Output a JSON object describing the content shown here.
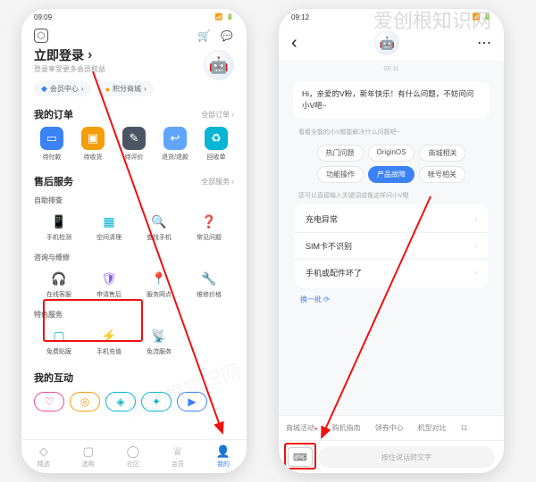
{
  "watermark": "爱创根知识网",
  "phone1": {
    "time": "09:09",
    "login_title": "立即登录",
    "login_sub": "登录享受更多会员权益",
    "pills": {
      "member": "会员中心",
      "points": "积分商城"
    },
    "sections": {
      "orders": {
        "title": "我的订单",
        "more": "全部订单 ›",
        "items": [
          "待付款",
          "待收货",
          "待评价",
          "退货/退款",
          "回收单"
        ]
      },
      "aftersale": {
        "title": "售后服务",
        "more": "全部服务 ›"
      },
      "selfcheck": {
        "title": "自助排查",
        "items": [
          "手机检测",
          "空间清理",
          "查找手机",
          "常见问题"
        ]
      },
      "consult": {
        "title": "咨询与维修",
        "items": [
          "在线客服",
          "申请售后",
          "服务网点",
          "维修价格"
        ]
      },
      "special": {
        "title": "特色服务",
        "items": [
          "免费贴膜",
          "手机充值",
          "免流服务",
          ""
        ]
      },
      "interact": {
        "title": "我的互动"
      }
    },
    "nav": [
      "精选",
      "选购",
      "社区",
      "会员",
      "我的"
    ]
  },
  "phone2": {
    "time": "09:12",
    "ts": "09:11",
    "greeting": "Hi，亲爱的V粉，新年快乐！有什么问题，不妨问问小V吧~",
    "helper1": "看看全能的小V都能解决什么问题吧~",
    "chips": [
      "热门问题",
      "OriginOS",
      "商城相关",
      "功能操作",
      "产品故障",
      "帐号相关"
    ],
    "active_chip": 4,
    "helper2": "您可以直接输入关键词或像这样问小V喔",
    "qa": [
      "充电异常",
      "SIM卡不识别",
      "手机或配件坏了"
    ],
    "refresh": "换一批",
    "bottom_tabs": [
      "商城活动",
      "购机指南",
      "领券中心",
      "机型对比",
      "以"
    ],
    "input_placeholder": "按住说话转文字"
  }
}
